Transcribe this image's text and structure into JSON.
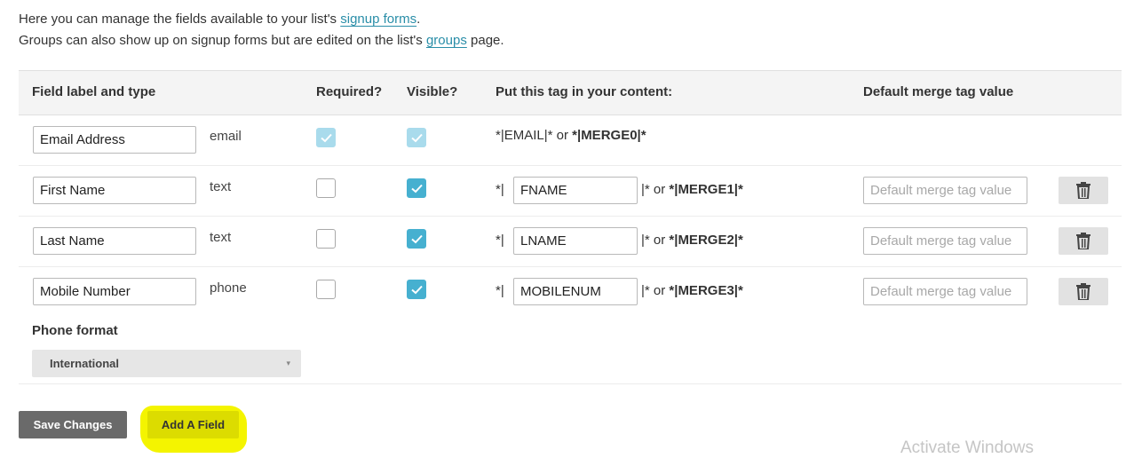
{
  "intro": {
    "line1_prefix": "Here you can manage the fields available to your list's ",
    "line1_link": "signup forms",
    "line1_suffix": ".",
    "line2_prefix": "Groups can also show up on signup forms but are edited on the list's ",
    "line2_link": "groups",
    "line2_suffix": " page."
  },
  "headers": {
    "field_label": "Field label and type",
    "required": "Required?",
    "visible": "Visible?",
    "tag": "Put this tag in your content:",
    "default": "Default merge tag value"
  },
  "rows": [
    {
      "label": "Email Address",
      "type": "email",
      "required": true,
      "visible": true,
      "locked": true,
      "tag_full_prefix": "*|EMAIL|* or ",
      "merge": "*|MERGE0|*"
    },
    {
      "label": "First Name",
      "type": "text",
      "required": false,
      "visible": true,
      "tag_open": "*|",
      "tag": "FNAME",
      "tag_close_or": "|* or ",
      "merge": "*|MERGE1|*",
      "default_placeholder": "Default merge tag value"
    },
    {
      "label": "Last Name",
      "type": "text",
      "required": false,
      "visible": true,
      "tag_open": "*|",
      "tag": "LNAME",
      "tag_close_or": "|* or ",
      "merge": "*|MERGE2|*",
      "default_placeholder": "Default merge tag value"
    },
    {
      "label": "Mobile Number",
      "type": "phone",
      "required": false,
      "visible": true,
      "tag_open": "*|",
      "tag": "MOBILENUM",
      "tag_close_or": "|* or ",
      "merge": "*|MERGE3|*",
      "default_placeholder": "Default merge tag value"
    }
  ],
  "phone_format": {
    "label": "Phone format",
    "selected": "International"
  },
  "buttons": {
    "save": "Save Changes",
    "add": "Add A Field"
  },
  "watermark": "Activate Windows",
  "colors": {
    "link": "#2a8ea8",
    "checkbox_on": "#46b0d0",
    "highlight": "#f4f400"
  },
  "icons": [
    "check-icon",
    "trash-icon",
    "chevron-down-icon"
  ]
}
